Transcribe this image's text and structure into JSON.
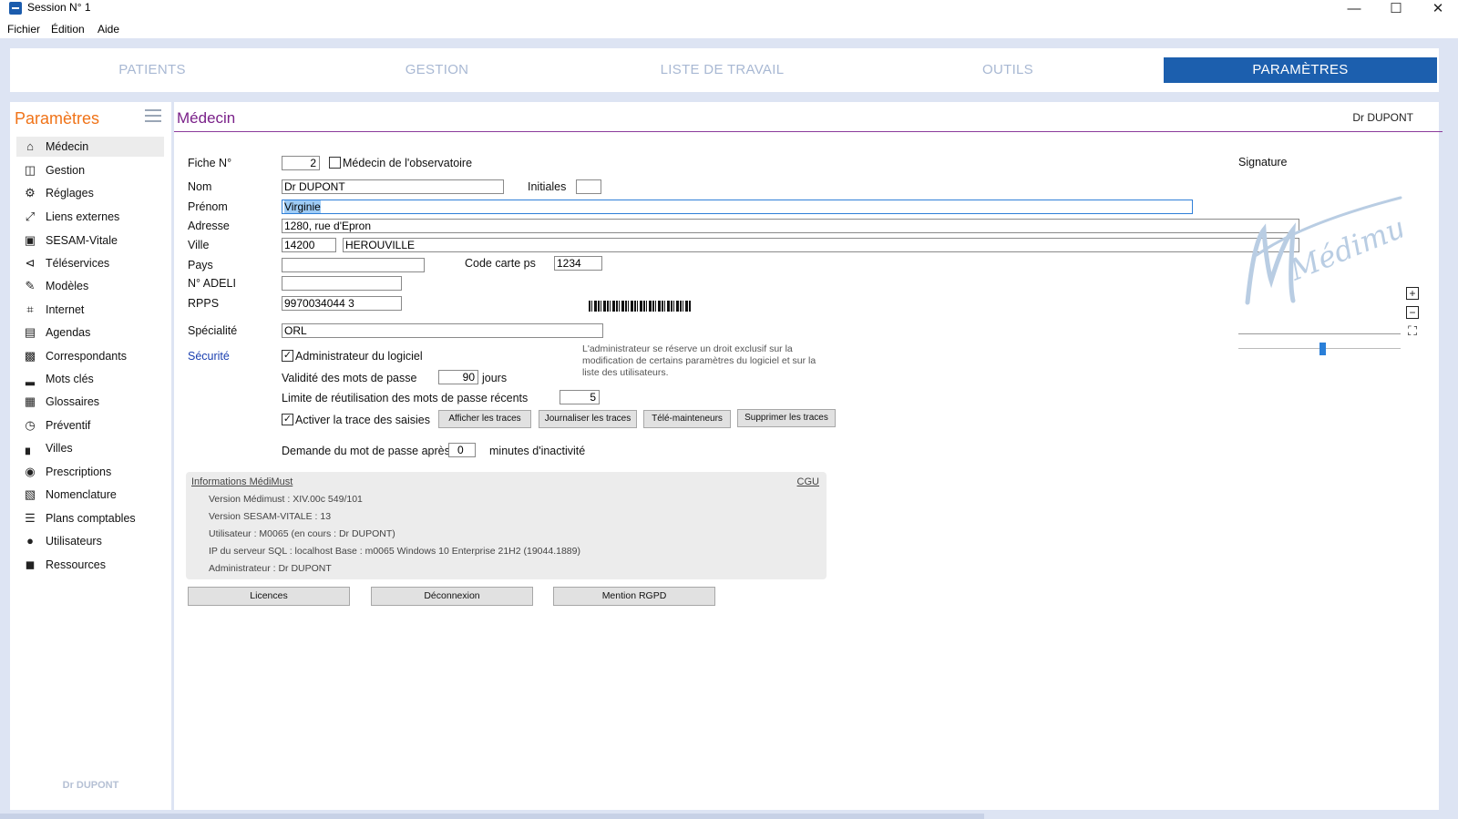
{
  "window": {
    "title": "Session N° 1"
  },
  "menu": {
    "items": [
      "Fichier",
      "Édition",
      "Aide"
    ]
  },
  "nav": {
    "tabs": [
      {
        "label": "PATIENTS",
        "active": false
      },
      {
        "label": "GESTION",
        "active": false
      },
      {
        "label": "LISTE DE TRAVAIL",
        "active": false
      },
      {
        "label": "OUTILS",
        "active": false
      },
      {
        "label": "PARAMÈTRES",
        "active": true
      }
    ],
    "active_color": "#1c5fae"
  },
  "sidebar": {
    "title": "Paramètres",
    "items": [
      {
        "label": "Médecin",
        "icon": "home-icon",
        "active": true
      },
      {
        "label": "Gestion",
        "icon": "inbox-icon"
      },
      {
        "label": "Réglages",
        "icon": "cogs-icon"
      },
      {
        "label": "Liens externes",
        "icon": "expand-icon"
      },
      {
        "label": "SESAM-Vitale",
        "icon": "card-terminal-icon"
      },
      {
        "label": "Téléservices",
        "icon": "share-icon"
      },
      {
        "label": "Modèles",
        "icon": "edit-icon"
      },
      {
        "label": "Internet",
        "icon": "wifi-icon"
      },
      {
        "label": "Agendas",
        "icon": "calendar-icon"
      },
      {
        "label": "Correspondants",
        "icon": "contact-book-icon"
      },
      {
        "label": "Mots clés",
        "icon": "bar-chart-icon"
      },
      {
        "label": "Glossaires",
        "icon": "book-icon"
      },
      {
        "label": "Préventif",
        "icon": "clock-icon"
      },
      {
        "label": "Villes",
        "icon": "city-icon"
      },
      {
        "label": "Prescriptions",
        "icon": "pills-icon"
      },
      {
        "label": "Nomenclature",
        "icon": "document-icon"
      },
      {
        "label": "Plans comptables",
        "icon": "list-icon"
      },
      {
        "label": "Utilisateurs",
        "icon": "users-icon"
      },
      {
        "label": "Ressources",
        "icon": "car-icon"
      }
    ],
    "footer": "Dr DUPONT"
  },
  "main": {
    "title": "Médecin",
    "user": "Dr DUPONT",
    "form": {
      "fiche_label": "Fiche N°",
      "fiche_value": "2",
      "observatoire_label": "Médecin de l'observatoire",
      "nom_label": "Nom",
      "nom_value": "Dr DUPONT",
      "initiales_label": "Initiales",
      "initiales_value": "",
      "prenom_label": "Prénom",
      "prenom_value": "Virginie",
      "adresse_label": "Adresse",
      "adresse_value": "1280, rue d'Epron",
      "ville_label": "Ville",
      "cp_value": "14200",
      "ville_value": "HEROUVILLE",
      "pays_label": "Pays",
      "pays_value": "",
      "carte_label": "Code carte ps",
      "carte_value": "1234",
      "adeli_label": "N° ADELI",
      "adeli_value": "",
      "rpps_label": "RPPS",
      "rpps_value": "9970034044 3",
      "specialite_label": "Spécialité",
      "specialite_value": "ORL"
    },
    "security": {
      "label": "Sécurité",
      "admin_label": "Administrateur du logiciel",
      "admin_checked": true,
      "admin_note": "L'administrateur se réserve un droit exclusif sur la modification de certains paramètres du logiciel et sur la liste des utilisateurs.",
      "validite_label": "Validité des mots de passe",
      "validite_value": "90",
      "validite_unit": "jours",
      "limite_label": "Limite de réutilisation des mots de passe récents",
      "limite_value": "5",
      "trace_label": "Activer la trace des saisies",
      "trace_checked": true,
      "buttons": [
        "Afficher les traces",
        "Journaliser les traces",
        "Télé-mainteneurs",
        "Supprimer les traces"
      ],
      "demande_label": "Demande du mot de passe après",
      "demande_value": "0",
      "demande_unit": "minutes d'inactivité"
    },
    "info": {
      "title": "Informations MédiMust",
      "cgu": "CGU",
      "lines": [
        "Version Médimust : XIV.00c     549/101",
        "Version SESAM-VITALE : 13",
        "Utilisateur : M0065   (en cours : Dr DUPONT)",
        "IP du serveur SQL : localhost    Base : m0065       Windows 10 Enterprise 21H2 (19044.1889)",
        "Administrateur : Dr DUPONT"
      ]
    },
    "bottom_buttons": [
      "Licences",
      "Déconnexion",
      "Mention RGPD"
    ],
    "signature": {
      "label": "Signature",
      "image_text": "Médimust"
    }
  }
}
